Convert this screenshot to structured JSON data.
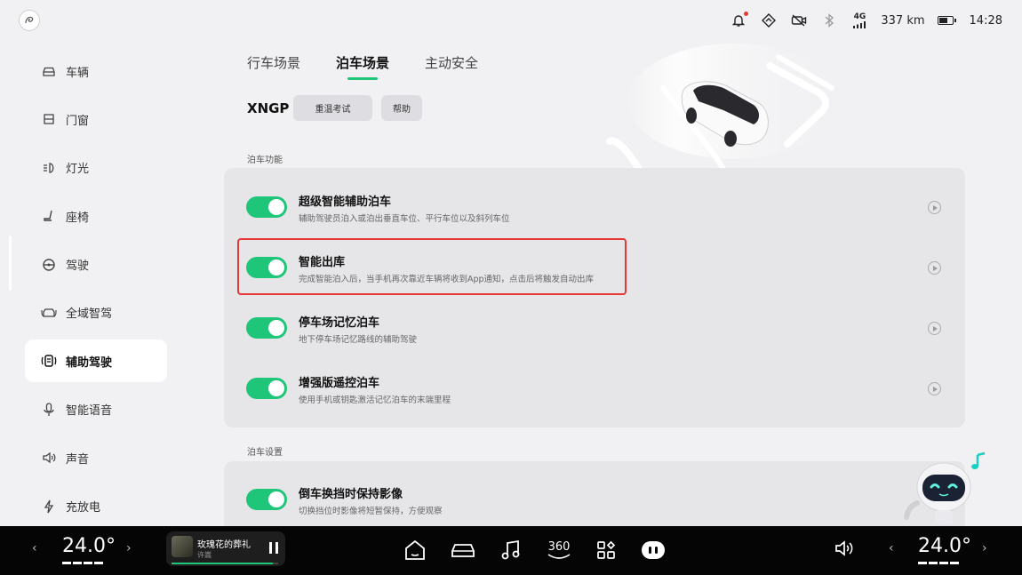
{
  "status": {
    "range": "337 km",
    "time": "14:28",
    "signal": "4G"
  },
  "sidebar": {
    "items": [
      {
        "label": "车辆",
        "icon": "car-icon"
      },
      {
        "label": "门窗",
        "icon": "door-icon"
      },
      {
        "label": "灯光",
        "icon": "headlight-icon"
      },
      {
        "label": "座椅",
        "icon": "seat-icon"
      },
      {
        "label": "驾驶",
        "icon": "steering-wheel-icon"
      },
      {
        "label": "全域智驾",
        "icon": "smart-drive-icon"
      },
      {
        "label": "辅助驾驶",
        "icon": "assist-drive-icon",
        "active": true
      },
      {
        "label": "智能语音",
        "icon": "microphone-icon"
      },
      {
        "label": "声音",
        "icon": "speaker-icon"
      },
      {
        "label": "充放电",
        "icon": "charge-icon"
      }
    ]
  },
  "tabs": [
    {
      "label": "行车场景"
    },
    {
      "label": "泊车场景",
      "active": true
    },
    {
      "label": "主动安全"
    }
  ],
  "xngp": {
    "label": "XNGP",
    "retake_label": "重温考试",
    "help_label": "帮助"
  },
  "parking_functions": {
    "section_label": "泊车功能",
    "rows": [
      {
        "title": "超级智能辅助泊车",
        "desc": "辅助驾驶员泊入或泊出垂直车位、平行车位以及斜列车位",
        "enabled": true
      },
      {
        "title": "智能出库",
        "desc": "完成智能泊入后，当手机再次靠近车辆将收到App通知，点击后将触发自动出库",
        "enabled": true
      },
      {
        "title": "停车场记忆泊车",
        "desc": "地下停车场记忆路线的辅助驾驶",
        "enabled": true
      },
      {
        "title": "增强版遥控泊车",
        "desc": "使用手机或钥匙激活记忆泊车的末端里程",
        "enabled": true
      }
    ]
  },
  "parking_settings": {
    "section_label": "泊车设置",
    "rows": [
      {
        "title": "倒车换挡时保持影像",
        "desc": "切换挡位时影像将短暂保持，方便观察",
        "enabled": true
      }
    ]
  },
  "bottom_bar": {
    "left_temp": "24.0°",
    "right_temp": "24.0°",
    "song": "玫瑰花的葬礼",
    "artist": "许嵩",
    "progress": 0.95,
    "dock_360_label": "360"
  },
  "colors": {
    "accent": "#1fc67a",
    "highlight": "#e53935"
  }
}
